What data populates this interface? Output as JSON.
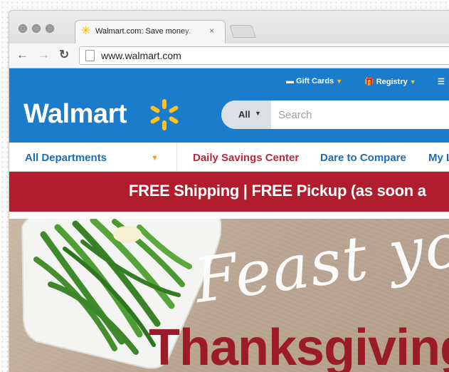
{
  "browser": {
    "tab_title": "Walmart.com: Save money.",
    "tab_close": "×",
    "url": "www.walmart.com"
  },
  "header": {
    "logo_text": "Walmart",
    "utility_links": [
      {
        "label": "Gift Cards"
      },
      {
        "label": "Registry"
      }
    ],
    "search": {
      "category": "All",
      "placeholder": "Search"
    }
  },
  "nav": {
    "items": [
      {
        "label": "All Departments"
      },
      {
        "label": "Daily Savings Center"
      },
      {
        "label": "Dare to Compare"
      },
      {
        "label": "My L"
      }
    ]
  },
  "promo": {
    "text": "FREE Shipping | FREE Pickup (as soon a"
  },
  "hero": {
    "script_text": "Feast yo",
    "headline": "Thanksgiving"
  },
  "colors": {
    "brand_blue": "#1a7cca",
    "spark_yellow": "#ffc220",
    "promo_red": "#b01d2c",
    "headline_red": "#9b1b29",
    "nav_blue": "#1a6dbd",
    "nav_red": "#c2263a"
  }
}
